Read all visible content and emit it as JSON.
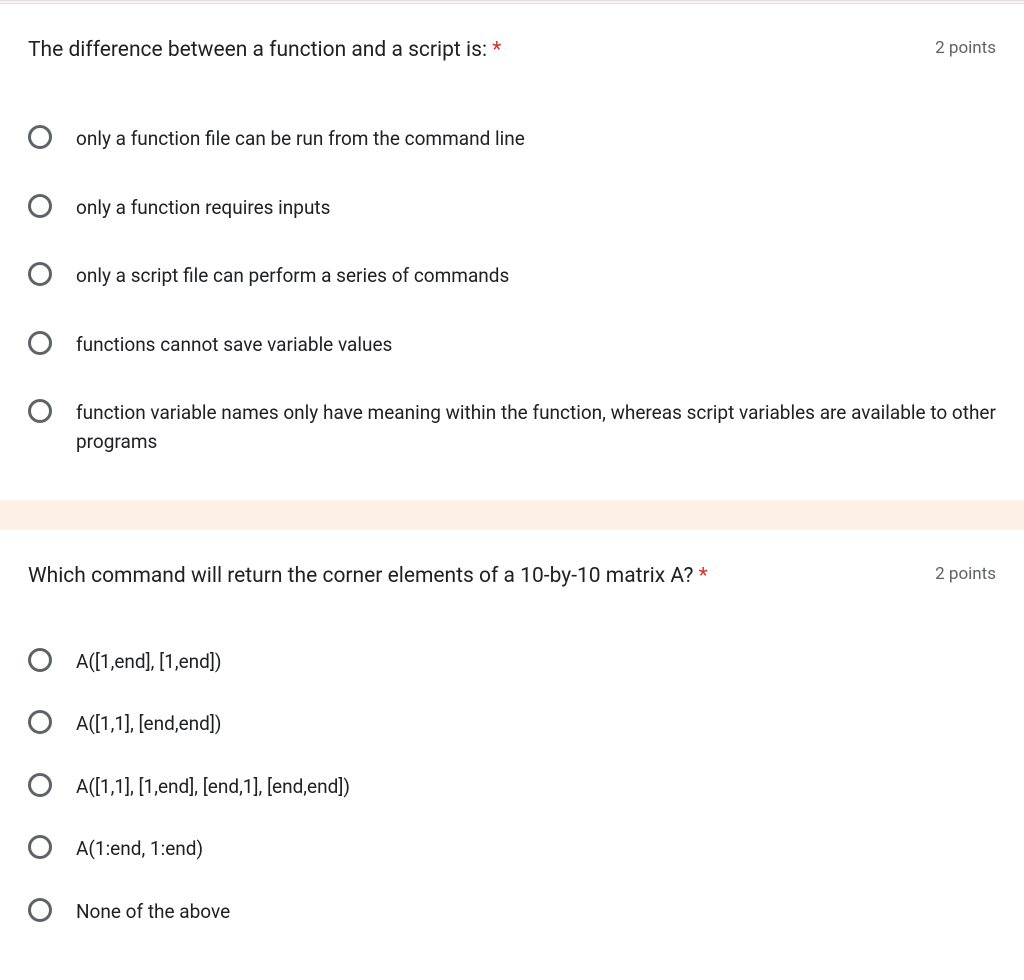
{
  "questions": [
    {
      "title": "The difference between a function and a script is:",
      "required": true,
      "points": "2 points",
      "options": [
        "only a function file can be run from the command line",
        "only a function requires inputs",
        "only a script file can perform a series of commands",
        "functions cannot save variable values",
        "function variable names only have meaning within the function, whereas script variables are available to other programs"
      ]
    },
    {
      "title": "Which command will return the corner elements of a 10-by-10 matrix A?",
      "required": true,
      "points": "2 points",
      "options": [
        "A([1,end], [1,end])",
        "A([1,1], [end,end])",
        "A([1,1], [1,end], [end,1], [end,end])",
        "A(1:end, 1:end)",
        "None of the above"
      ]
    }
  ],
  "required_marker": "*"
}
